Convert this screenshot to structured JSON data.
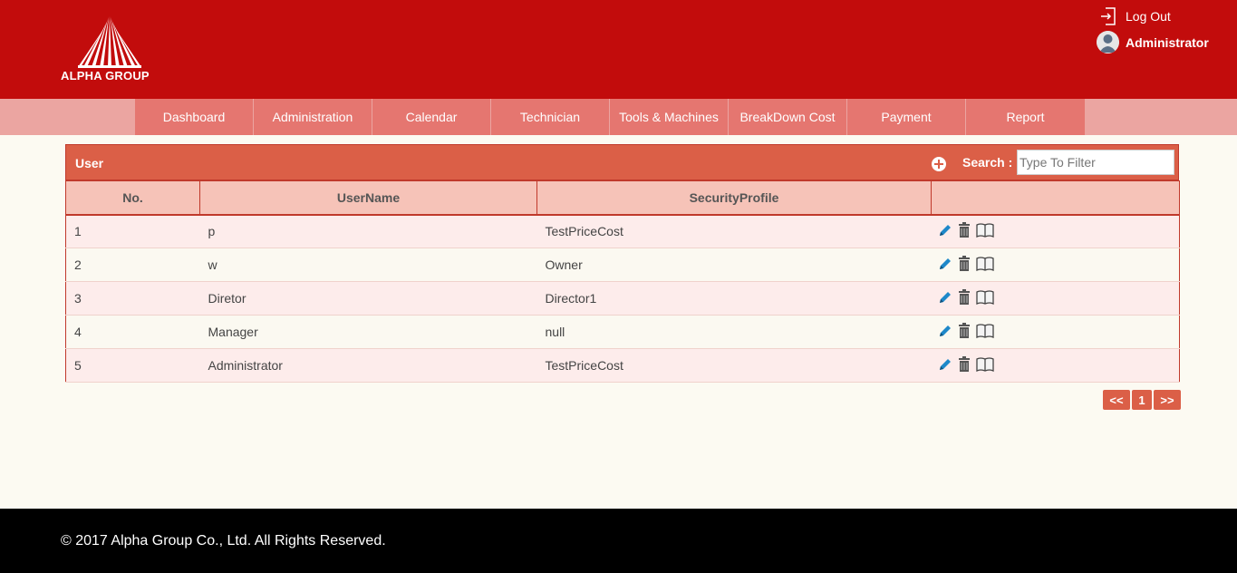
{
  "header": {
    "logo_text": "ALPHA GROUP",
    "logout_label": "Log Out",
    "user_name": "Administrator"
  },
  "nav": [
    {
      "label": "Dashboard"
    },
    {
      "label": "Administration"
    },
    {
      "label": "Calendar"
    },
    {
      "label": "Technician"
    },
    {
      "label": "Tools & Machines"
    },
    {
      "label": "BreakDown Cost"
    },
    {
      "label": "Payment"
    },
    {
      "label": "Report"
    }
  ],
  "panel": {
    "title": "User",
    "search_label": "Search :",
    "search_placeholder": "Type To Filter",
    "search_value": ""
  },
  "table": {
    "headers": [
      "No.",
      "UserName",
      "SecurityProfile",
      ""
    ],
    "rows": [
      {
        "no": "1",
        "username": "p",
        "profile": "TestPriceCost"
      },
      {
        "no": "2",
        "username": "w",
        "profile": "Owner"
      },
      {
        "no": "3",
        "username": "Diretor",
        "profile": "Director1"
      },
      {
        "no": "4",
        "username": "Manager",
        "profile": "null"
      },
      {
        "no": "5",
        "username": "Administrator",
        "profile": "TestPriceCost"
      }
    ]
  },
  "pager": {
    "prev": "<<",
    "current": "1",
    "next": ">>"
  },
  "footer": {
    "copyright": "© 2017 Alpha Group Co., Ltd. All Rights Reserved."
  },
  "colors": {
    "header_red": "#c20c0c",
    "nav_bg": "#eba5a1",
    "nav_item": "#e57670",
    "panel_head": "#db5f47",
    "table_header": "#f6c3b8"
  }
}
